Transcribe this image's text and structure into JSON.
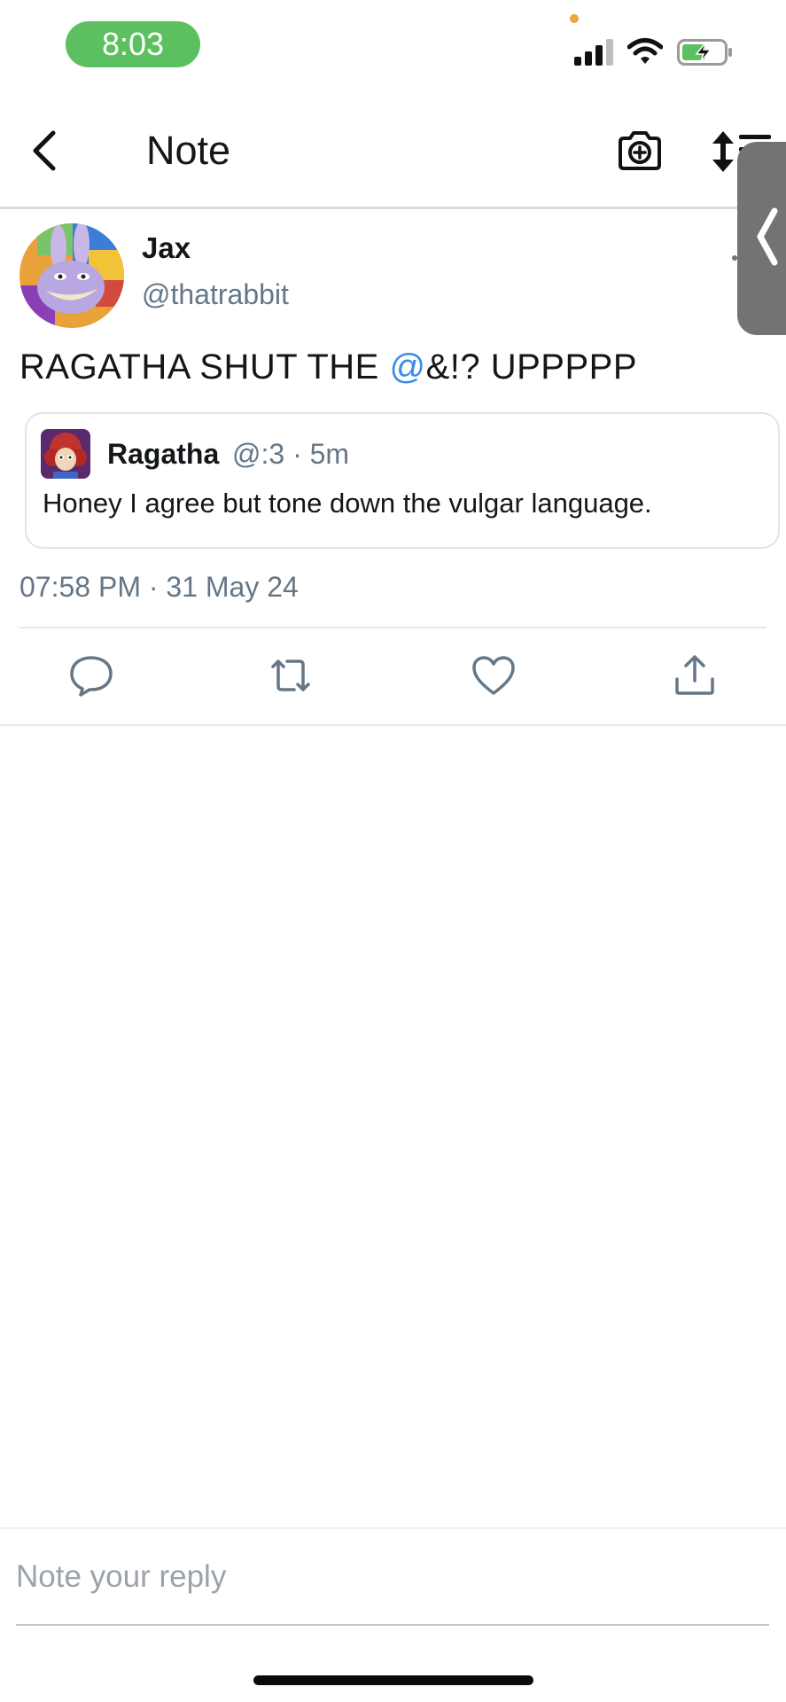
{
  "status_bar": {
    "time": "8:03"
  },
  "nav": {
    "title": "Note"
  },
  "post": {
    "display_name": "Jax",
    "handle": "@thatrabbit",
    "text_before": "RAGATHA SHUT THE ",
    "text_mention": "@",
    "text_after": "&!? UPPPPP",
    "timestamp": "07:58 PM · 31 May 24"
  },
  "quote": {
    "display_name": "Ragatha",
    "meta": "@:3 · 5m",
    "text": "Honey I agree but tone down the vulgar language."
  },
  "composer": {
    "placeholder": "Note your reply"
  },
  "colors": {
    "accent": "#3a8ee6",
    "status_pill": "#5cc060",
    "muted_text": "#657786"
  },
  "icons": [
    "chevron-left-icon",
    "camera-plus-icon",
    "sort-icon",
    "reply-icon",
    "retweet-icon",
    "heart-icon",
    "share-icon"
  ]
}
